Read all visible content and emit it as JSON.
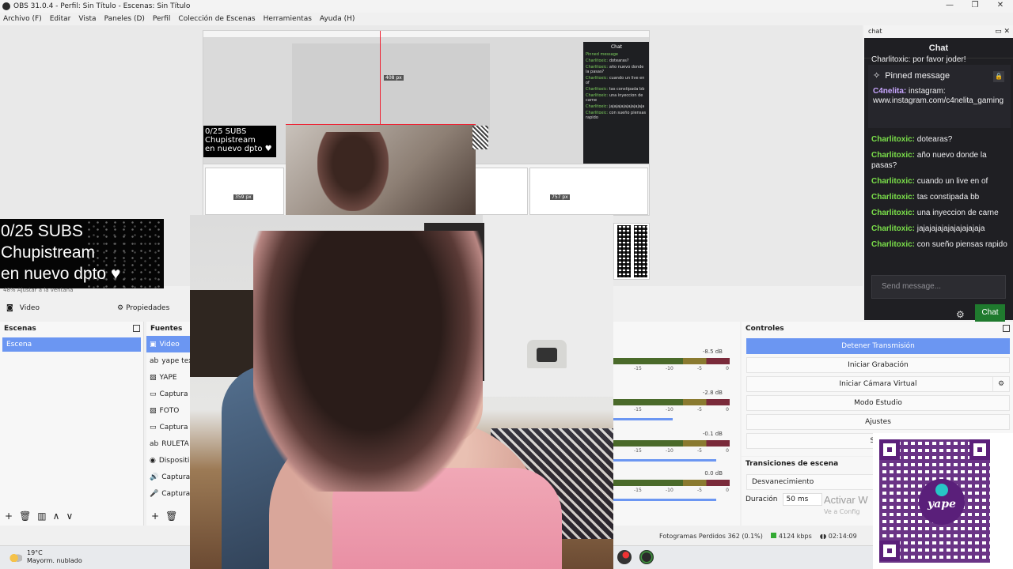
{
  "window": {
    "title": "OBS 31.0.4 - Perfil: Sin Título - Escenas: Sin Título",
    "controls": [
      "—",
      "❐",
      "✕"
    ]
  },
  "menu": [
    "Archivo (F)",
    "Editar",
    "Vista",
    "Paneles (D)",
    "Perfil",
    "Colección de Escenas",
    "Herramientas",
    "Ayuda (H)"
  ],
  "preview": {
    "subs_overlay": [
      "0/25 SUBS",
      "Chupistream",
      "en nuevo dpto ♥"
    ],
    "nested_subs": [
      "0/25 SUBS",
      "Chupistream",
      "en nuevo dpto ♥"
    ],
    "px_labels": [
      "408 px",
      "359 px",
      "757 px"
    ],
    "nested_chat_title": "Chat",
    "nested_chat_lines": [
      {
        "u": "Pinned message",
        "t": ""
      },
      {
        "u": "Charlitoxic:",
        "t": "dotearas?"
      },
      {
        "u": "Charlitoxic:",
        "t": "año nuevo donde la pasas?"
      },
      {
        "u": "Charlitoxic:",
        "t": "cuando un live en of"
      },
      {
        "u": "Charlitoxic:",
        "t": "tas constipada bb"
      },
      {
        "u": "Charlitoxic:",
        "t": "una inyeccion de carne"
      },
      {
        "u": "Charlitoxic:",
        "t": "jajajajajajajajajaja"
      },
      {
        "u": "Charlitoxic:",
        "t": "con sueño piensas rapido"
      }
    ],
    "zoom": "48%   Ajustar a la ventana"
  },
  "toolbar": {
    "source_label": "Video",
    "properties": "Propiedades"
  },
  "scenes": {
    "title": "Escenas",
    "items": [
      "Escena"
    ]
  },
  "sources": {
    "title": "Fuentes",
    "items": [
      {
        "icon": "▣",
        "label": "Video"
      },
      {
        "icon": "ab",
        "label": "yape text"
      },
      {
        "icon": "▨",
        "label": "YAPE"
      },
      {
        "icon": "▭",
        "label": "Captura"
      },
      {
        "icon": "▨",
        "label": "FOTO"
      },
      {
        "icon": "▭",
        "label": "Captura"
      },
      {
        "icon": "ab",
        "label": "RULETA"
      },
      {
        "icon": "◉",
        "label": "Dispositi"
      },
      {
        "icon": "🔊",
        "label": "Captura"
      },
      {
        "icon": "🎤",
        "label": "Captura"
      }
    ]
  },
  "mixer": {
    "channels": [
      "-8.5 dB",
      "-2.8 dB",
      "-0.1 dB",
      "0.0 dB"
    ],
    "scale": [
      "-15",
      "-10",
      "-5",
      "0"
    ]
  },
  "controls": {
    "title": "Controles",
    "buttons": [
      "Detener Transmisión",
      "Iniciar Grabación",
      "Iniciar Cámara Virtual",
      "Modo Estudio",
      "Ajustes",
      "Salir"
    ]
  },
  "transitions": {
    "title": "Transiciones de escena",
    "selected": "Desvanecimiento",
    "duration_label": "Duración",
    "duration_value": "50 ms"
  },
  "watermark": {
    "line1": "Activar W",
    "line2": "Ve a Config"
  },
  "status": {
    "dropped": "Fotogramas Perdidos 362 (0.1%)",
    "bitrate": "4124 kbps",
    "time": "02:14:09"
  },
  "chat": {
    "dock_title": "chat",
    "header": "Chat",
    "cut_line": "Charlitoxic: por favor joder!",
    "pinned_title": "Pinned message",
    "pinned_user": "C4nelita:",
    "pinned_text": "instagram: www.instagram.com/c4nelita_gaming",
    "messages": [
      {
        "u": "Charlitoxic:",
        "t": "dotearas?"
      },
      {
        "u": "Charlitoxic:",
        "t": "año nuevo donde la pasas?"
      },
      {
        "u": "Charlitoxic:",
        "t": "cuando un live en of"
      },
      {
        "u": "Charlitoxic:",
        "t": "tas constipada bb"
      },
      {
        "u": "Charlitoxic:",
        "t": "una inyeccion de carne"
      },
      {
        "u": "Charlitoxic:",
        "t": "jajajajajajajajajajaja"
      },
      {
        "u": "Charlitoxic:",
        "t": "con sueño piensas rapido"
      }
    ],
    "input_placeholder": "Send message...",
    "send_label": "Chat"
  },
  "taskbar": {
    "temp": "19°C",
    "weather": "Mayorm. nublado"
  },
  "qr": {
    "logo": "yape"
  }
}
